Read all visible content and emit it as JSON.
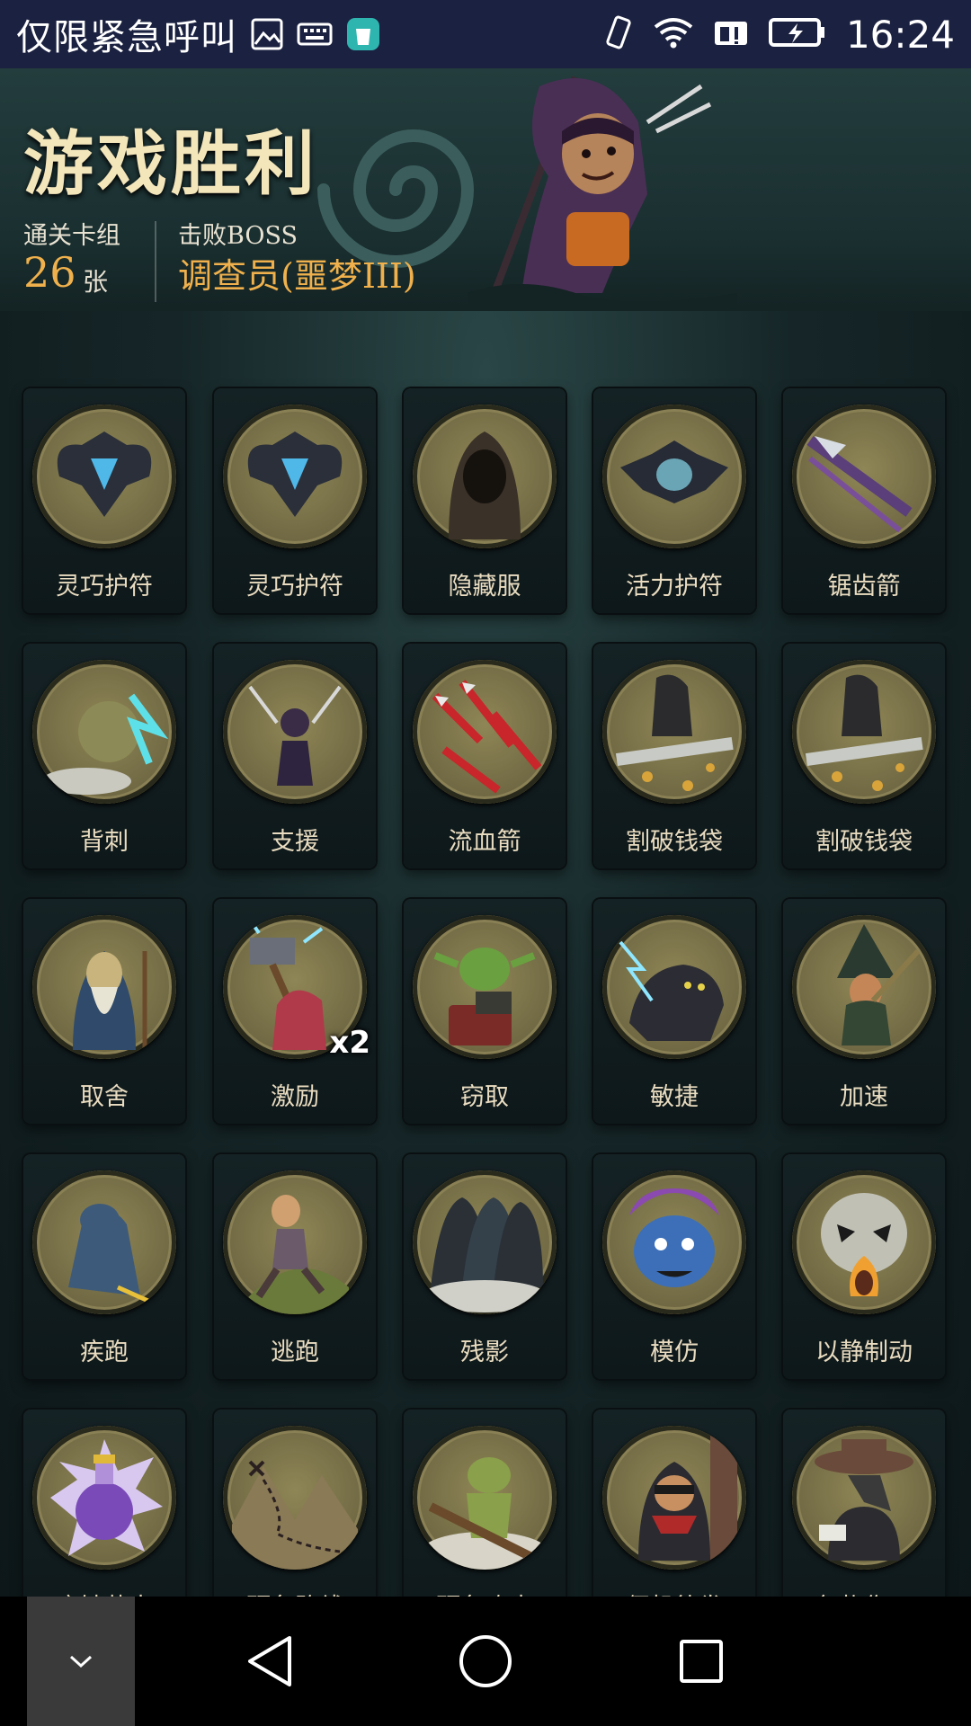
{
  "status_bar": {
    "carrier_text": "仅限紧急呼叫",
    "time": "16:24"
  },
  "header": {
    "title": "游戏胜利",
    "deck_label": "通关卡组",
    "deck_count": "26",
    "deck_unit": "张",
    "boss_label": "击败BOSS",
    "boss_name": "调查员(噩梦III)"
  },
  "cards": [
    {
      "name": "灵巧护符",
      "icon": "shield-amulet-icon",
      "badge": ""
    },
    {
      "name": "灵巧护符",
      "icon": "shield-amulet-icon",
      "badge": ""
    },
    {
      "name": "隐藏服",
      "icon": "hooded-cloak-icon",
      "badge": ""
    },
    {
      "name": "活力护符",
      "icon": "bat-amulet-icon",
      "badge": ""
    },
    {
      "name": "锯齿箭",
      "icon": "serrated-arrow-icon",
      "badge": ""
    },
    {
      "name": "背刺",
      "icon": "backstab-icon",
      "badge": ""
    },
    {
      "name": "支援",
      "icon": "support-icon",
      "badge": ""
    },
    {
      "name": "流血箭",
      "icon": "bleeding-arrows-icon",
      "badge": ""
    },
    {
      "name": "割破钱袋",
      "icon": "slash-purse-icon",
      "badge": ""
    },
    {
      "name": "割破钱袋",
      "icon": "slash-purse-icon",
      "badge": ""
    },
    {
      "name": "取舍",
      "icon": "old-sage-icon",
      "badge": ""
    },
    {
      "name": "激励",
      "icon": "hammer-warrior-icon",
      "badge": "x2"
    },
    {
      "name": "窃取",
      "icon": "goblin-thief-icon",
      "badge": ""
    },
    {
      "name": "敏捷",
      "icon": "panther-icon",
      "badge": ""
    },
    {
      "name": "加速",
      "icon": "witch-icon",
      "badge": ""
    },
    {
      "name": "疾跑",
      "icon": "running-wolf-icon",
      "badge": ""
    },
    {
      "name": "逃跑",
      "icon": "fleeing-man-icon",
      "badge": ""
    },
    {
      "name": "残影",
      "icon": "afterimage-icon",
      "badge": ""
    },
    {
      "name": "模仿",
      "icon": "blue-troll-icon",
      "badge": ""
    },
    {
      "name": "以静制动",
      "icon": "skull-flame-icon",
      "badge": ""
    },
    {
      "name": "腐蚀药水",
      "icon": "potion-icon",
      "badge": ""
    },
    {
      "name": "预备路线",
      "icon": "map-route-icon",
      "badge": ""
    },
    {
      "name": "预备攻击",
      "icon": "goblin-attack-icon",
      "badge": ""
    },
    {
      "name": "伺机待发",
      "icon": "ninja-icon",
      "badge": ""
    },
    {
      "name": "包扎伤口",
      "icon": "plague-doctor-icon",
      "badge": ""
    }
  ],
  "colors": {
    "status_bar": "#1b2140",
    "title": "#f4e6bb",
    "accent": "#f0b14c",
    "card_text": "#e9dcc0"
  }
}
